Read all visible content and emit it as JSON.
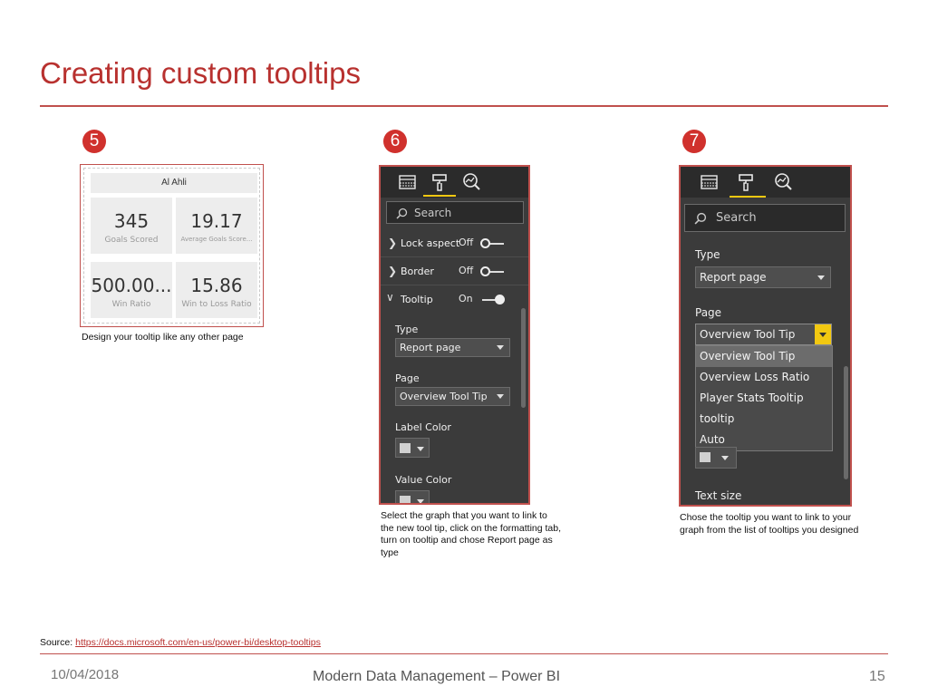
{
  "slide": {
    "title": "Creating custom tooltips",
    "source_prefix": "Source: ",
    "source_link": "https://docs.microsoft.com/en-us/power-bi/desktop-tooltips",
    "footer_date": "10/04/2018",
    "footer_center": "Modern Data Management – Power BI",
    "footer_page": "15",
    "accent_color": "#c0504d"
  },
  "steps": [
    {
      "number": "5",
      "caption": "Design your tooltip like any other page"
    },
    {
      "number": "6",
      "caption": "Select the graph that you want to link to the new tool tip, click on the formatting tab, turn on tooltip and chose Report page as type"
    },
    {
      "number": "7",
      "caption": "Chose the tooltip you want to link to your graph from the list of tooltips you designed"
    }
  ],
  "tooltip_page": {
    "header": "Al Ahli",
    "cards": [
      {
        "value": "345",
        "label": "Goals Scored"
      },
      {
        "value": "19.17",
        "label": "Average Goals Score..."
      },
      {
        "value": "500.00...",
        "label": "Win Ratio"
      },
      {
        "value": "15.86",
        "label": "Win to Loss Ratio"
      }
    ]
  },
  "format_pane": {
    "tab_icons": [
      "fields-grid-icon",
      "paint-roller-icon",
      "analytics-magnifier-icon"
    ],
    "search_placeholder": "Search",
    "rows": [
      {
        "label": "Lock aspect",
        "value": "Off",
        "expanded": false
      },
      {
        "label": "Border",
        "value": "Off",
        "expanded": false
      },
      {
        "label": "Tooltip",
        "value": "On",
        "expanded": true
      }
    ],
    "type_label": "Type",
    "type_value": "Report page",
    "page_label": "Page",
    "page_value": "Overview Tool Tip",
    "label_color": "Label Color",
    "value_color": "Value Color"
  },
  "page_pane": {
    "search_placeholder": "Search",
    "type_label": "Type",
    "type_value": "Report page",
    "page_label": "Page",
    "page_value": "Overview Tool Tip",
    "options": [
      "Overview Tool Tip",
      "Overview Loss Ratio",
      "Player Stats Tooltip",
      "tooltip",
      "Auto"
    ],
    "text_size_label": "Text size"
  }
}
